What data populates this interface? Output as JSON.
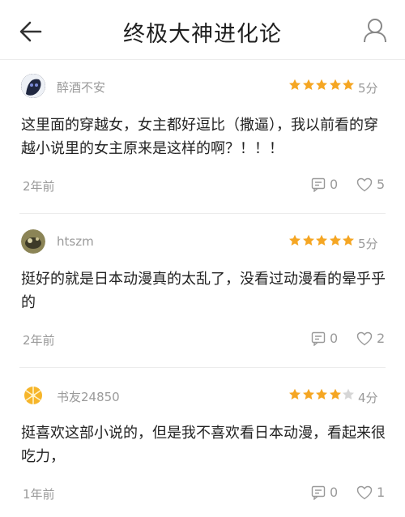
{
  "header": {
    "title": "终极大神进化论",
    "back_icon": "back-arrow-icon",
    "user_icon": "user-icon"
  },
  "colors": {
    "star_filled": "#f5a623",
    "star_empty": "#d6d6d6",
    "meta_text": "#9a9a9a"
  },
  "reviews": [
    {
      "username": "醉酒不安",
      "stars": 5,
      "score": "5分",
      "content": "这里面的穿越女，女主都好逗比（撒逼），我以前看的穿越小说里的女主原来是这样的啊？！！！",
      "time": "2年前",
      "replies": "0",
      "likes": "5"
    },
    {
      "username": "htszm",
      "stars": 5,
      "score": "5分",
      "content": "挺好的就是日本动漫真的太乱了，没看过动漫看的晕乎乎的",
      "time": "2年前",
      "replies": "0",
      "likes": "2"
    },
    {
      "username": "书友24850",
      "stars": 4,
      "score": "4分",
      "content": "挺喜欢这部小说的，但是我不喜欢看日本动漫，看起来很吃力，",
      "time": "1年前",
      "replies": "0",
      "likes": "1"
    }
  ]
}
